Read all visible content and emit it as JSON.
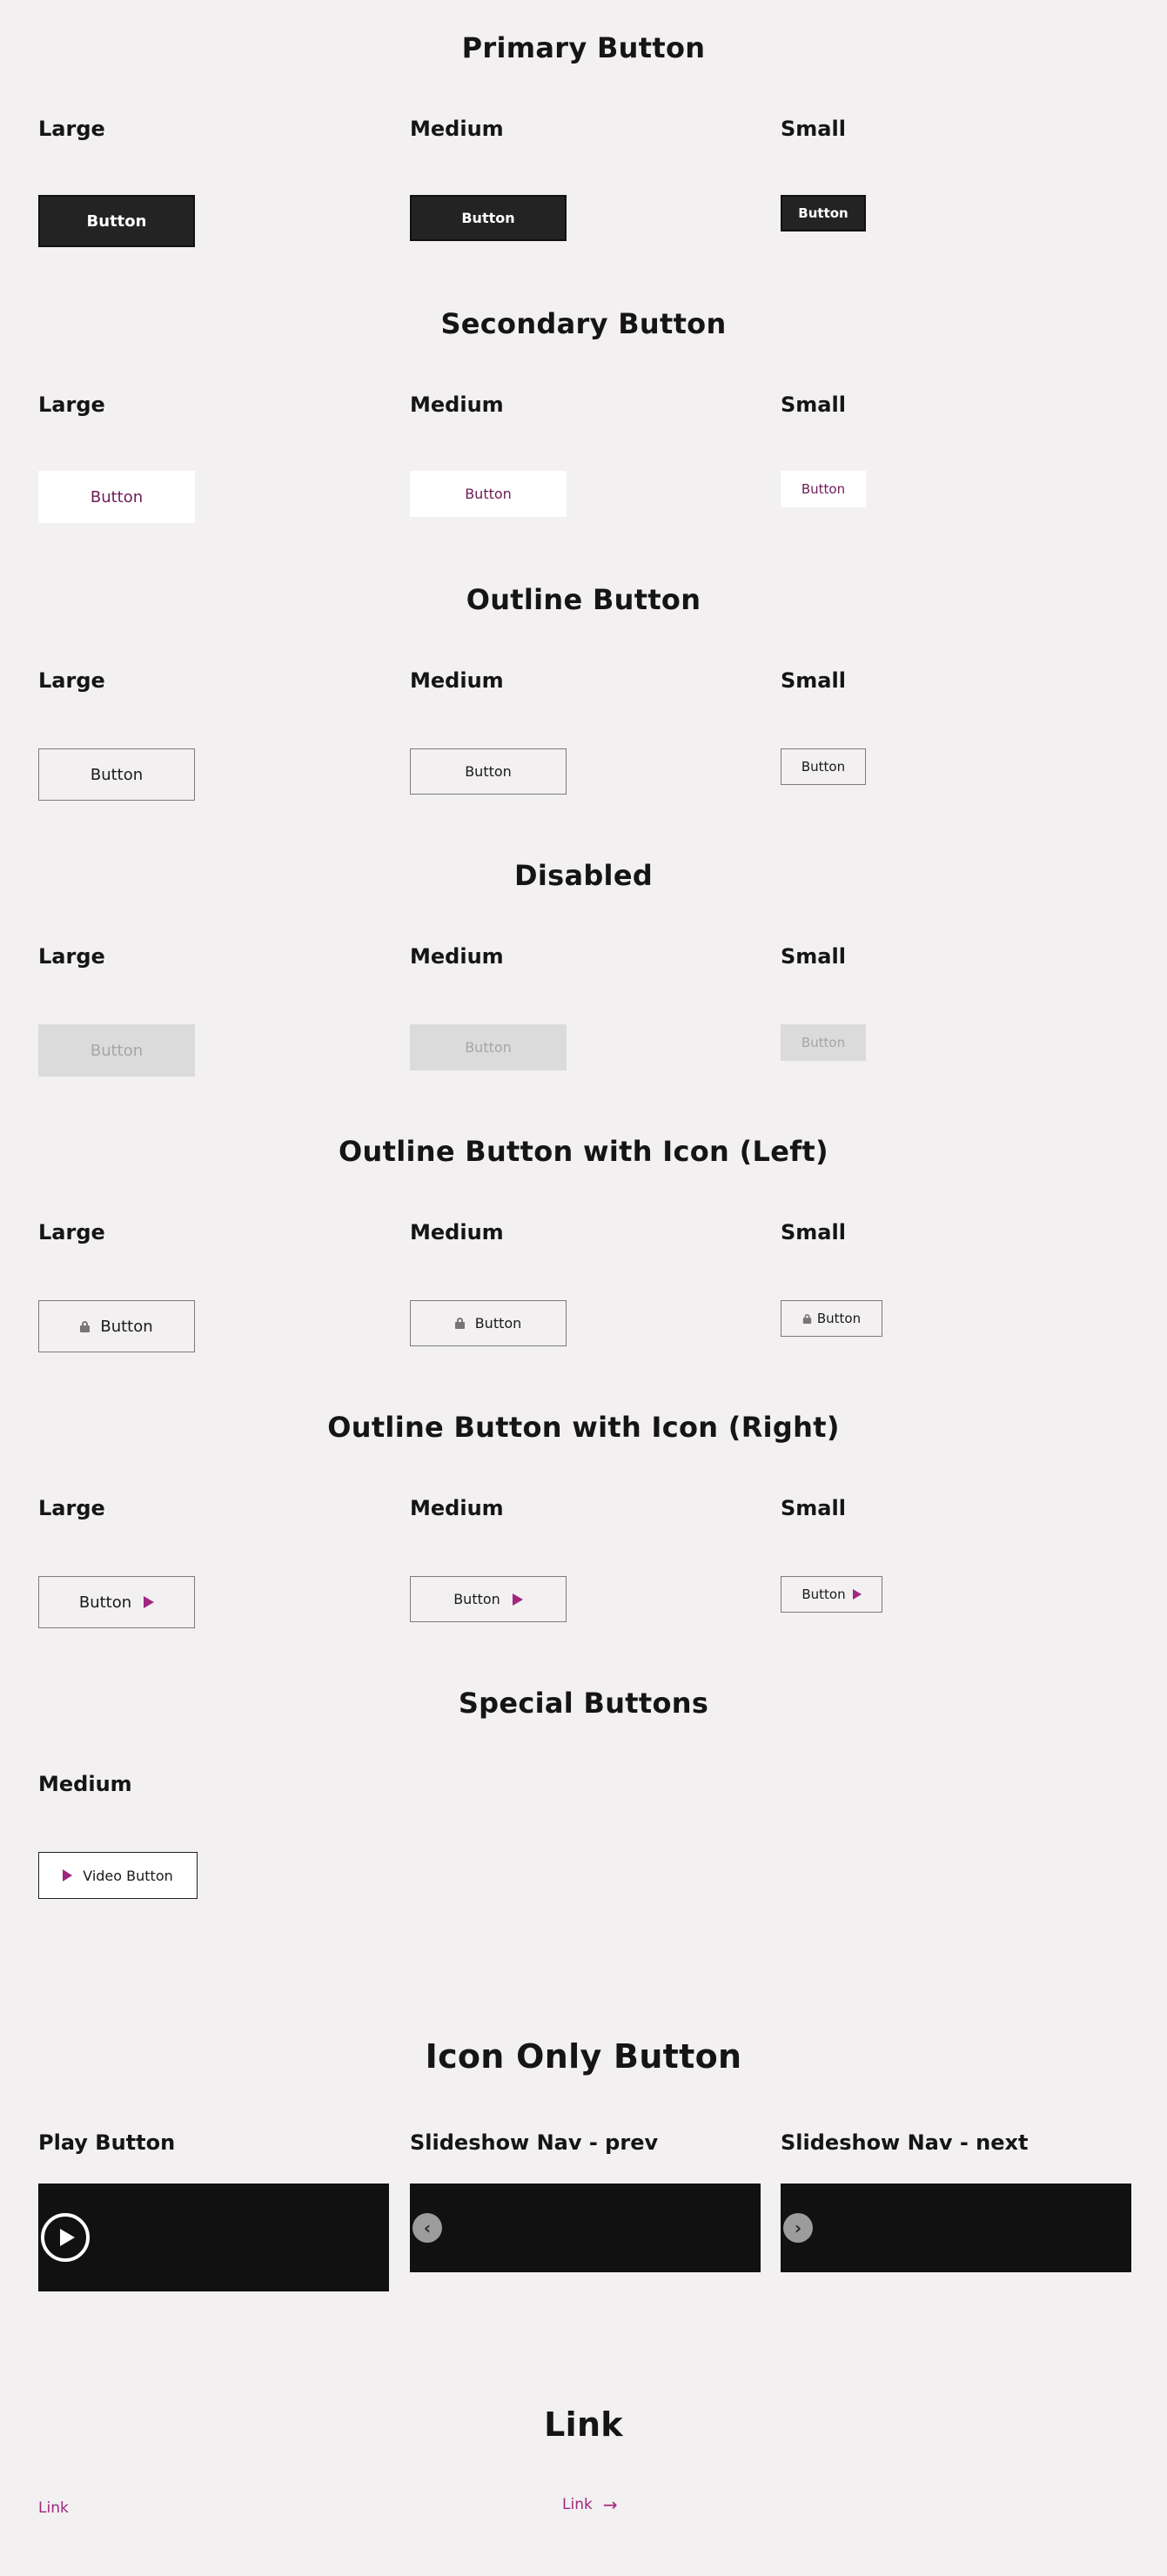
{
  "sections": {
    "primary": {
      "title": "Primary Button"
    },
    "secondary": {
      "title": "Secondary Button"
    },
    "outline": {
      "title": "Outline Button"
    },
    "disabled": {
      "title": "Disabled"
    },
    "icon_left": {
      "title": "Outline Button with Icon (Left)"
    },
    "icon_right": {
      "title": "Outline Button with Icon (Right)"
    },
    "special": {
      "title": "Special Buttons"
    },
    "icon_only": {
      "title": "Icon Only Button"
    },
    "link": {
      "title": "Link"
    }
  },
  "sizes": {
    "large": "Large",
    "medium": "Medium",
    "small": "Small"
  },
  "button_label": "Button",
  "special": {
    "size_label": "Medium",
    "video_label": "Video Button"
  },
  "icon_only": {
    "play_label": "Play Button",
    "prev_label": "Slideshow Nav - prev",
    "next_label": "Slideshow Nav - next",
    "prev_icon": "‹",
    "next_icon": "›"
  },
  "links": {
    "plain": "Link",
    "arrow": "Link",
    "arrow_icon": "→"
  },
  "colors": {
    "accent": "#a0277f",
    "primary_bg": "#232323",
    "secondary_text": "#6e1b57",
    "page_bg": "#f2f0f1"
  }
}
